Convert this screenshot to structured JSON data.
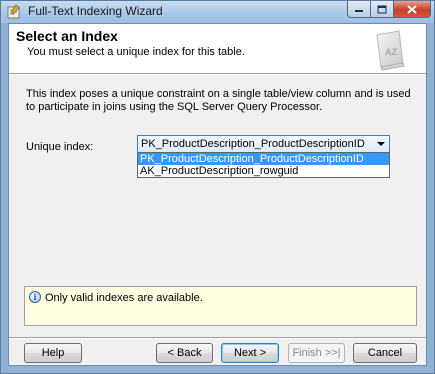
{
  "window": {
    "title": "Full-Text Indexing Wizard"
  },
  "header": {
    "title": "Select an Index",
    "subtitle": "You must select a unique index for this table.",
    "art_text": "AZ"
  },
  "description": "This index poses a unique constraint on a single table/view column and is used to participate in joins using the SQL Server Query Processor.",
  "unique_index": {
    "label": "Unique index:",
    "selected_value": "PK_ProductDescription_ProductDescriptionID",
    "options": [
      "PK_ProductDescription_ProductDescriptionID",
      "AK_ProductDescription_rowguid"
    ],
    "highlighted_option": 0
  },
  "info": {
    "message": "Only valid indexes are available.",
    "icon": "info-icon"
  },
  "buttons": {
    "help": "Help",
    "back": "< Back",
    "next": "Next >",
    "finish": "Finish >>|",
    "cancel": "Cancel"
  },
  "colors": {
    "selection": "#3399ff",
    "info_background": "#ffffe1",
    "title_bar": "#a9c7e6",
    "close_button": "#c8412b"
  }
}
